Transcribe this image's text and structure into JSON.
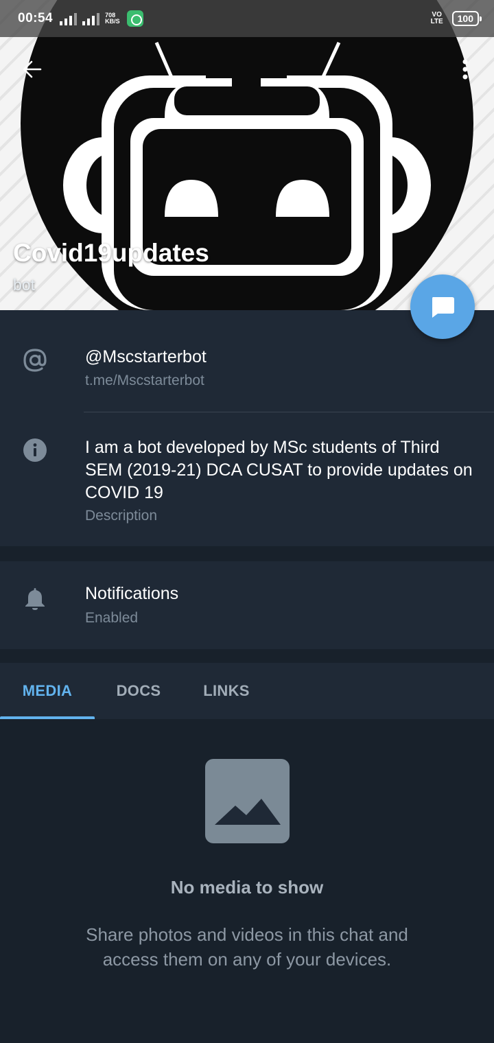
{
  "status_bar": {
    "time": "00:54",
    "network_speed": "708",
    "network_unit": "KB/S",
    "volte": "VO LTE",
    "battery": "100"
  },
  "header": {
    "name": "Covid19updates",
    "subtitle": "bot",
    "back_icon": "arrow-left-icon",
    "more_icon": "more-vertical-icon",
    "fab_icon": "message-icon"
  },
  "info": {
    "username": "@Mscstarterbot",
    "link": "t.me/Mscstarterbot",
    "description": "I am a bot developed by MSc students of Third SEM (2019-21) DCA CUSAT to  provide updates on COVID 19",
    "description_label": "Description"
  },
  "notifications": {
    "title": "Notifications",
    "status": "Enabled"
  },
  "tabs": [
    {
      "label": "MEDIA",
      "active": true
    },
    {
      "label": "DOCS",
      "active": false
    },
    {
      "label": "LINKS",
      "active": false
    }
  ],
  "empty_state": {
    "icon": "image-icon",
    "title": "No media to show",
    "description": "Share photos and videos in this chat and access them on any of your devices."
  },
  "colors": {
    "accent": "#62b3ee",
    "fab": "#5aa6e6",
    "background": "#18212b",
    "surface": "#1f2936"
  }
}
